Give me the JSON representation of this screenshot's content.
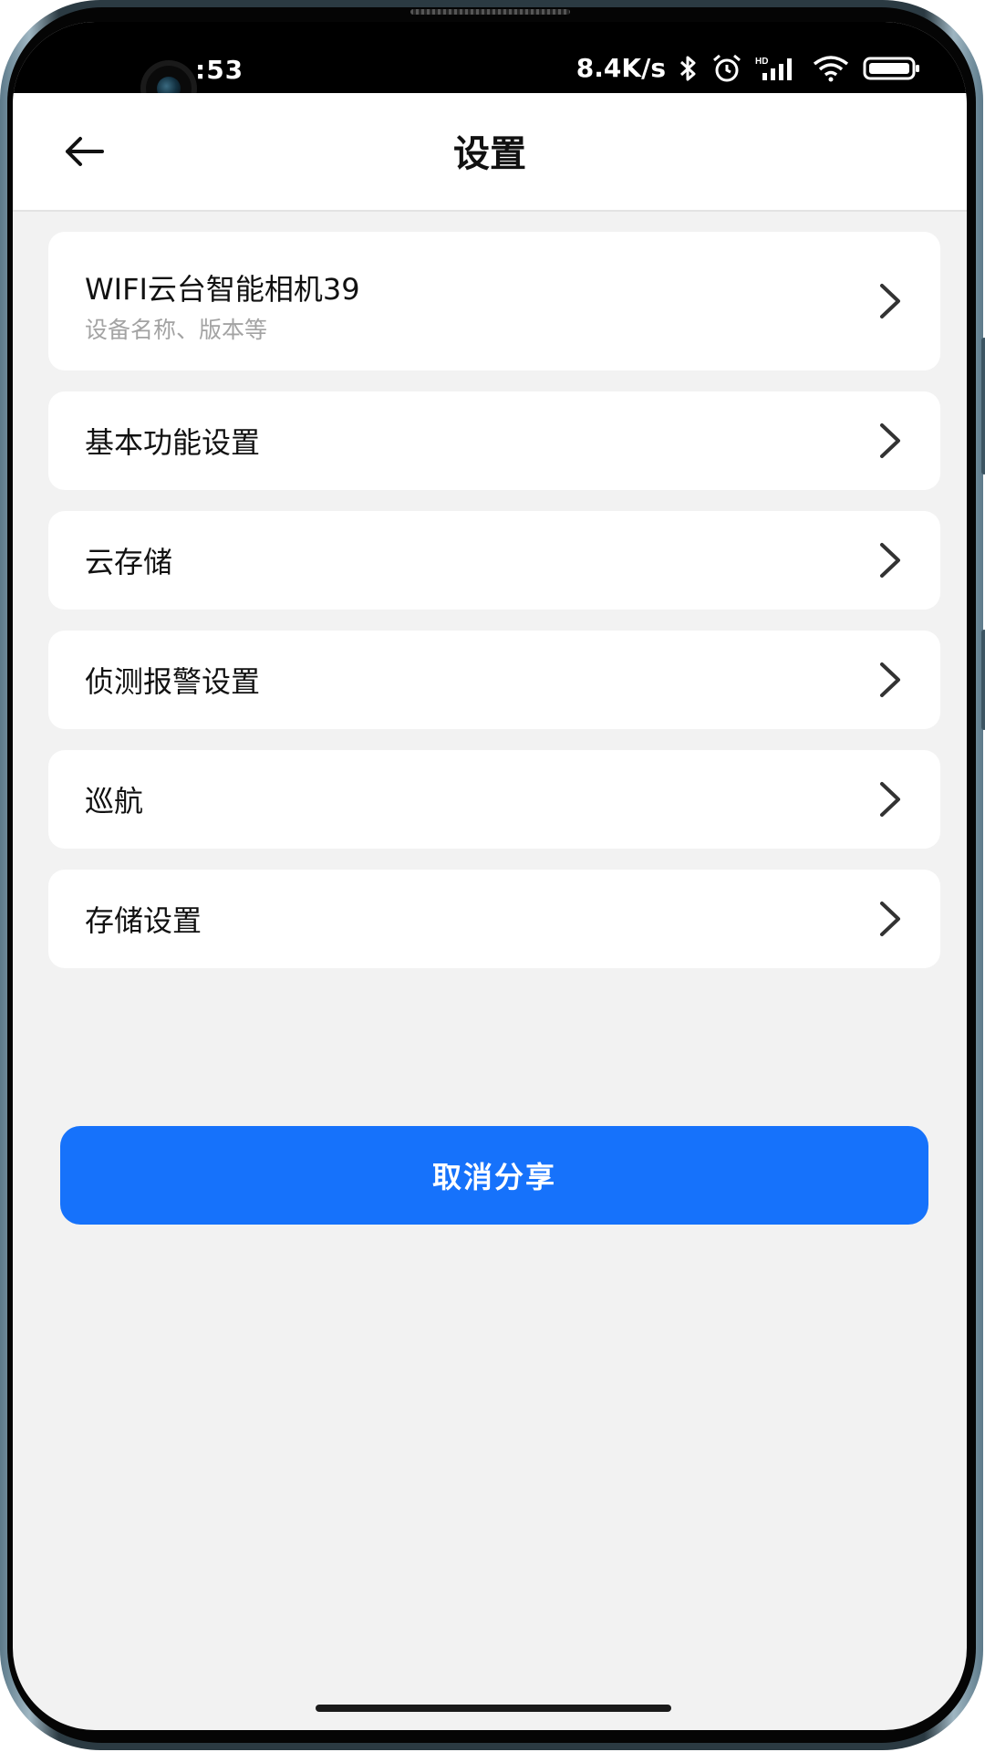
{
  "status_bar": {
    "time": ":53",
    "network_speed": "8.4K/s",
    "icons": [
      "bluetooth-icon",
      "alarm-icon",
      "hd-signal-icon",
      "wifi-icon",
      "battery-icon"
    ],
    "hd_label": "HD"
  },
  "header": {
    "title": "设置",
    "back_icon": "arrow-left-icon"
  },
  "device": {
    "name": "WIFI云台智能相机39",
    "subtitle": "设备名称、版本等"
  },
  "menu_items": [
    {
      "label": "基本功能设置"
    },
    {
      "label": "云存储"
    },
    {
      "label": "侦测报警设置"
    },
    {
      "label": "巡航"
    },
    {
      "label": "存储设置"
    }
  ],
  "actions": {
    "cancel_share_label": "取消分享"
  },
  "colors": {
    "accent": "#1672fb",
    "background": "#f2f2f2",
    "card": "#ffffff",
    "subtitle": "#a3a3a3"
  }
}
